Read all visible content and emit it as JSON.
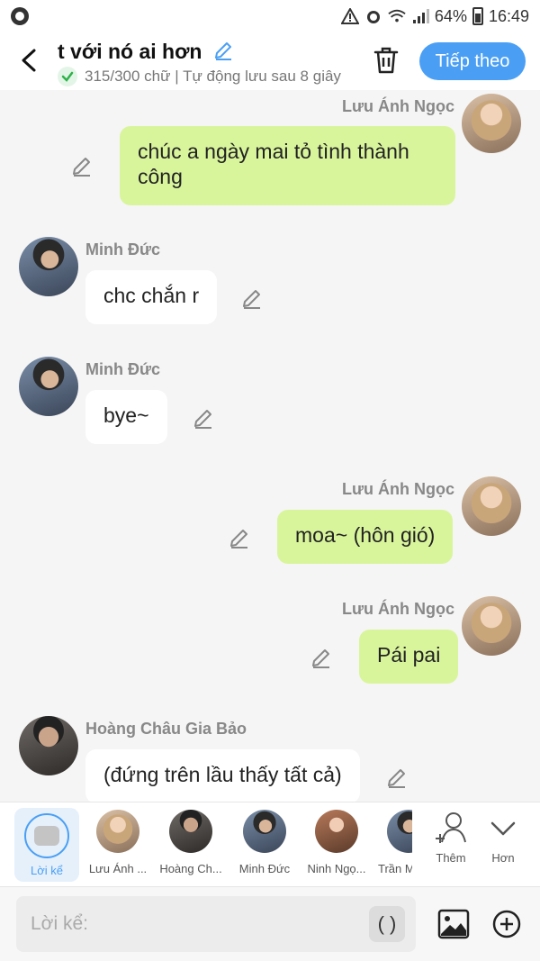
{
  "status_bar": {
    "battery": "64%",
    "time": "16:49"
  },
  "header": {
    "title": "t với nó ai hơn",
    "subtitle": "315/300 chữ | Tự động lưu sau 8 giây",
    "next_button": "Tiếp theo"
  },
  "messages": [
    {
      "sender": "Lưu Ánh Ngọc",
      "text_line1": "chúc a ngày mai tỏ tình thành",
      "text_line2": "công",
      "side": "right"
    },
    {
      "sender": "Minh Đức",
      "text": "chc chắn r",
      "side": "left"
    },
    {
      "sender": "Minh Đức",
      "text": "bye~",
      "side": "left"
    },
    {
      "sender": "Lưu Ánh Ngọc",
      "text": "moa~ (hôn gió)",
      "side": "right"
    },
    {
      "sender": "Lưu Ánh Ngọc",
      "text": "Pái pai",
      "side": "right"
    },
    {
      "sender": "Hoàng Châu Gia Bảo",
      "text": "(đứng trên lầu thấy tất cả)",
      "side": "left"
    }
  ],
  "suggestions": {
    "narration": "Lời kể",
    "characters": [
      "Lưu Ánh ...",
      "Hoàng Ch...",
      "Minh Đức",
      "Ninh Ngọ...",
      "Trần M"
    ],
    "add": "Thêm",
    "more": "Hơn"
  },
  "input": {
    "placeholder": "Lời kể:",
    "paren_button": "( )"
  },
  "colors": {
    "accent": "#4a9ff5",
    "my_bubble": "#d9f59c",
    "their_bubble": "#ffffff",
    "background": "#f5f5f5"
  }
}
